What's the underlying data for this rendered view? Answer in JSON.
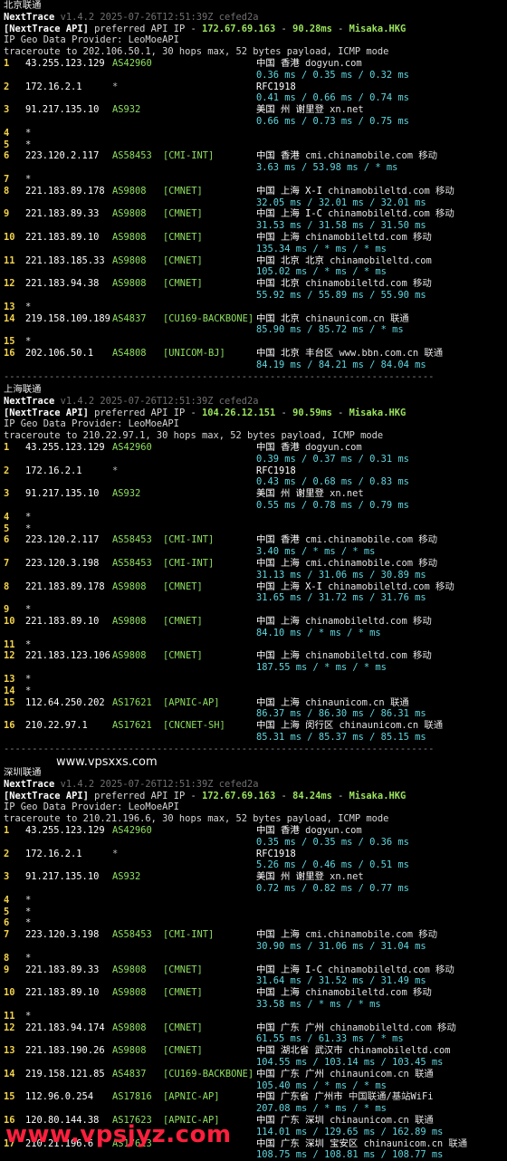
{
  "sections": [
    {
      "name": "北京联通",
      "header": {
        "app": "NextTrace",
        "version": "v1.4.2 2025-07-26T12:51:39Z cefed2a",
        "api_label": "[NextTrace API]",
        "api_text": "preferred API IP - ",
        "api_ip": "172.67.69.163",
        "api_latency": "90.28ms",
        "api_node": "Misaka.HKG",
        "geo_provider": "IP Geo Data Provider: LeoMoeAPI",
        "traceroute": "traceroute to 202.106.50.1, 30 hops max, 52 bytes payload, ICMP mode"
      },
      "hops": [
        {
          "n": "1",
          "ip": "43.255.123.129",
          "asn": "AS42960",
          "tag": "",
          "geo": "中国 香港",
          "dom": "dogyun.com",
          "isp": "",
          "rtt": "0.36 ms / 0.35 ms / 0.32 ms"
        },
        {
          "n": "2",
          "ip": "172.16.2.1",
          "asn": "*",
          "tag": "",
          "geo": "RFC1918",
          "dom": "",
          "isp": "",
          "rtt": "0.41 ms / 0.66 ms / 0.74 ms"
        },
        {
          "n": "3",
          "ip": "91.217.135.10",
          "asn": "AS932",
          "tag": "",
          "geo": "美国 州 谢里登",
          "dom": "xn.net",
          "isp": "",
          "rtt": "0.66 ms / 0.73 ms / 0.75 ms"
        },
        {
          "n": "4",
          "star": true
        },
        {
          "n": "5",
          "star": true
        },
        {
          "n": "6",
          "ip": "223.120.2.117",
          "asn": "AS58453",
          "tag": "[CMI-INT]",
          "geo": "中国 香港",
          "dom": "cmi.chinamobile.com",
          "isp": "移动",
          "rtt": "3.63 ms / 53.98 ms / * ms"
        },
        {
          "n": "7",
          "star": true
        },
        {
          "n": "8",
          "ip": "221.183.89.178",
          "asn": "AS9808",
          "tag": "[CMNET]",
          "geo": "中国 上海  X-I",
          "dom": "chinamobileltd.com",
          "isp": "移动",
          "rtt": "32.05 ms / 32.01 ms / 32.01 ms"
        },
        {
          "n": "9",
          "ip": "221.183.89.33",
          "asn": "AS9808",
          "tag": "[CMNET]",
          "geo": "中国 上海  I-C",
          "dom": "chinamobileltd.com",
          "isp": "移动",
          "rtt": "31.53 ms / 31.58 ms / 31.50 ms"
        },
        {
          "n": "10",
          "ip": "221.183.89.10",
          "asn": "AS9808",
          "tag": "[CMNET]",
          "geo": "中国 上海",
          "dom": "chinamobileltd.com",
          "isp": "移动",
          "rtt": "135.34 ms / * ms / * ms"
        },
        {
          "n": "11",
          "ip": "221.183.185.33",
          "asn": "AS9808",
          "tag": "[CMNET]",
          "geo": "中国 北京 北京",
          "dom": "chinamobileltd.com",
          "isp": "",
          "rtt": "105.02 ms / * ms / * ms"
        },
        {
          "n": "12",
          "ip": "221.183.94.38",
          "asn": "AS9808",
          "tag": "[CMNET]",
          "geo": "中国 北京",
          "dom": "chinamobileltd.com",
          "isp": "移动",
          "rtt": "55.92 ms / 55.89 ms / 55.90 ms"
        },
        {
          "n": "13",
          "star": true
        },
        {
          "n": "14",
          "ip": "219.158.109.189",
          "asn": "AS4837",
          "tag": "[CU169-BACKBONE]",
          "geo": "中国 北京",
          "dom": "chinaunicom.cn",
          "isp": "联通",
          "rtt": "85.90 ms / 85.72 ms / * ms"
        },
        {
          "n": "15",
          "star": true
        },
        {
          "n": "16",
          "ip": "202.106.50.1",
          "asn": "AS4808",
          "tag": "[UNICOM-BJ]",
          "geo": "中国 北京 丰台区",
          "dom": "www.bbn.com.cn",
          "isp": "联通",
          "rtt": "84.19 ms / 84.21 ms / 84.04 ms"
        }
      ]
    },
    {
      "name": "上海联通",
      "header": {
        "app": "NextTrace",
        "version": "v1.4.2 2025-07-26T12:51:39Z cefed2a",
        "api_label": "[NextTrace API]",
        "api_text": "preferred API IP - ",
        "api_ip": "104.26.12.151",
        "api_latency": "90.59ms",
        "api_node": "Misaka.HKG",
        "geo_provider": "IP Geo Data Provider: LeoMoeAPI",
        "traceroute": "traceroute to 210.22.97.1, 30 hops max, 52 bytes payload, ICMP mode"
      },
      "hops": [
        {
          "n": "1",
          "ip": "43.255.123.129",
          "asn": "AS42960",
          "tag": "",
          "geo": "中国 香港",
          "dom": "dogyun.com",
          "isp": "",
          "rtt": "0.39 ms / 0.37 ms / 0.31 ms"
        },
        {
          "n": "2",
          "ip": "172.16.2.1",
          "asn": "*",
          "tag": "",
          "geo": "RFC1918",
          "dom": "",
          "isp": "",
          "rtt": "0.43 ms / 0.68 ms / 0.83 ms"
        },
        {
          "n": "3",
          "ip": "91.217.135.10",
          "asn": "AS932",
          "tag": "",
          "geo": "美国 州 谢里登",
          "dom": "xn.net",
          "isp": "",
          "rtt": "0.55 ms / 0.78 ms / 0.79 ms"
        },
        {
          "n": "4",
          "star": true
        },
        {
          "n": "5",
          "star": true
        },
        {
          "n": "6",
          "ip": "223.120.2.117",
          "asn": "AS58453",
          "tag": "[CMI-INT]",
          "geo": "中国 香港",
          "dom": "cmi.chinamobile.com",
          "isp": "移动",
          "rtt": "3.40 ms / * ms / * ms"
        },
        {
          "n": "7",
          "ip": "223.120.3.198",
          "asn": "AS58453",
          "tag": "[CMI-INT]",
          "geo": "中国 上海",
          "dom": "cmi.chinamobile.com",
          "isp": "移动",
          "rtt": "31.13 ms / 31.06 ms / 30.89 ms"
        },
        {
          "n": "8",
          "ip": "221.183.89.178",
          "asn": "AS9808",
          "tag": "[CMNET]",
          "geo": "中国 上海  X-I",
          "dom": "chinamobileltd.com",
          "isp": "移动",
          "rtt": "31.65 ms / 31.72 ms / 31.76 ms"
        },
        {
          "n": "9",
          "star": true
        },
        {
          "n": "10",
          "ip": "221.183.89.10",
          "asn": "AS9808",
          "tag": "[CMNET]",
          "geo": "中国 上海",
          "dom": "chinamobileltd.com",
          "isp": "移动",
          "rtt": "84.10 ms / * ms / * ms"
        },
        {
          "n": "11",
          "star": true
        },
        {
          "n": "12",
          "ip": "221.183.123.106",
          "asn": "AS9808",
          "tag": "[CMNET]",
          "geo": "中国 上海",
          "dom": "chinamobileltd.com",
          "isp": "移动",
          "rtt": "187.55 ms / * ms / * ms"
        },
        {
          "n": "13",
          "star": true
        },
        {
          "n": "14",
          "star": true
        },
        {
          "n": "15",
          "ip": "112.64.250.202",
          "asn": "AS17621",
          "tag": "[APNIC-AP]",
          "geo": "中国 上海",
          "dom": "chinaunicom.cn",
          "isp": "联通",
          "rtt": "86.37 ms / 86.30 ms / 86.31 ms"
        },
        {
          "n": "16",
          "ip": "210.22.97.1",
          "asn": "AS17621",
          "tag": "[CNCNET-SH]",
          "geo": "中国 上海 闵行区",
          "dom": "chinaunicom.cn",
          "isp": "联通",
          "rtt": "85.31 ms / 85.37 ms / 85.15 ms"
        }
      ]
    },
    {
      "name": "深圳联通",
      "header": {
        "app": "NextTrace",
        "version": "v1.4.2 2025-07-26T12:51:39Z cefed2a",
        "api_label": "[NextTrace API]",
        "api_text": "preferred API IP - ",
        "api_ip": "172.67.69.163",
        "api_latency": "84.24ms",
        "api_node": "Misaka.HKG",
        "geo_provider": "IP Geo Data Provider: LeoMoeAPI",
        "traceroute": "traceroute to 210.21.196.6, 30 hops max, 52 bytes payload, ICMP mode"
      },
      "hops": [
        {
          "n": "1",
          "ip": "43.255.123.129",
          "asn": "AS42960",
          "tag": "",
          "geo": "中国 香港",
          "dom": "dogyun.com",
          "isp": "",
          "rtt": "0.35 ms / 0.35 ms / 0.36 ms"
        },
        {
          "n": "2",
          "ip": "172.16.2.1",
          "asn": "*",
          "tag": "",
          "geo": "RFC1918",
          "dom": "",
          "isp": "",
          "rtt": "5.26 ms / 0.46 ms / 0.51 ms"
        },
        {
          "n": "3",
          "ip": "91.217.135.10",
          "asn": "AS932",
          "tag": "",
          "geo": "美国 州 谢里登",
          "dom": "xn.net",
          "isp": "",
          "rtt": "0.72 ms / 0.82 ms / 0.77 ms"
        },
        {
          "n": "4",
          "star": true
        },
        {
          "n": "5",
          "star": true
        },
        {
          "n": "6",
          "star": true
        },
        {
          "n": "7",
          "ip": "223.120.3.198",
          "asn": "AS58453",
          "tag": "[CMI-INT]",
          "geo": "中国 上海",
          "dom": "cmi.chinamobile.com",
          "isp": "移动",
          "rtt": "30.90 ms / 31.06 ms / 31.04 ms"
        },
        {
          "n": "8",
          "star": true
        },
        {
          "n": "9",
          "ip": "221.183.89.33",
          "asn": "AS9808",
          "tag": "[CMNET]",
          "geo": "中国 上海  I-C",
          "dom": "chinamobileltd.com",
          "isp": "移动",
          "rtt": "31.64 ms / 31.52 ms / 31.49 ms"
        },
        {
          "n": "10",
          "ip": "221.183.89.10",
          "asn": "AS9808",
          "tag": "[CMNET]",
          "geo": "中国 上海",
          "dom": "chinamobileltd.com",
          "isp": "移动",
          "rtt": "33.58 ms / * ms / * ms"
        },
        {
          "n": "11",
          "star": true
        },
        {
          "n": "12",
          "ip": "221.183.94.174",
          "asn": "AS9808",
          "tag": "[CMNET]",
          "geo": "中国 广东 广州",
          "dom": "chinamobileltd.com",
          "isp": "移动",
          "rtt": "61.55 ms / 61.33 ms / * ms"
        },
        {
          "n": "13",
          "ip": "221.183.190.26",
          "asn": "AS9808",
          "tag": "[CMNET]",
          "geo": "中国 湖北省 武汉市",
          "dom": "chinamobileltd.com",
          "isp": "",
          "rtt": "104.55 ms / 103.14 ms / 103.45 ms"
        },
        {
          "n": "14",
          "ip": "219.158.121.85",
          "asn": "AS4837",
          "tag": "[CU169-BACKBONE]",
          "geo": "中国 广东 广州",
          "dom": "chinaunicom.cn",
          "isp": "联通",
          "rtt": "105.40 ms / * ms / * ms"
        },
        {
          "n": "15",
          "ip": "112.96.0.254",
          "asn": "AS17816",
          "tag": "[APNIC-AP]",
          "geo": "中国 广东省 广州市",
          "dom": "中国联通/基站WiFi",
          "isp": "",
          "rtt": "207.08 ms / * ms / * ms"
        },
        {
          "n": "16",
          "ip": "120.80.144.38",
          "asn": "AS17623",
          "tag": "[APNIC-AP]",
          "geo": "中国 广东 深圳",
          "dom": "chinaunicom.cn",
          "isp": "联通",
          "rtt": "114.01 ms / 129.65 ms / 162.89 ms"
        },
        {
          "n": "17",
          "ip": "210.21.196.6",
          "asn": "AS17623",
          "tag": "",
          "geo": "中国 广东 深圳 宝安区",
          "dom": "chinaunicom.cn",
          "isp": "联通",
          "rtt": "108.75 ms / 108.81 ms / 108.77 ms"
        }
      ]
    }
  ],
  "separator": "----------------------------------------------------------------------------",
  "watermark_small": "www.vpsxxs.com",
  "watermark_large": "www.vpsjyz.com"
}
